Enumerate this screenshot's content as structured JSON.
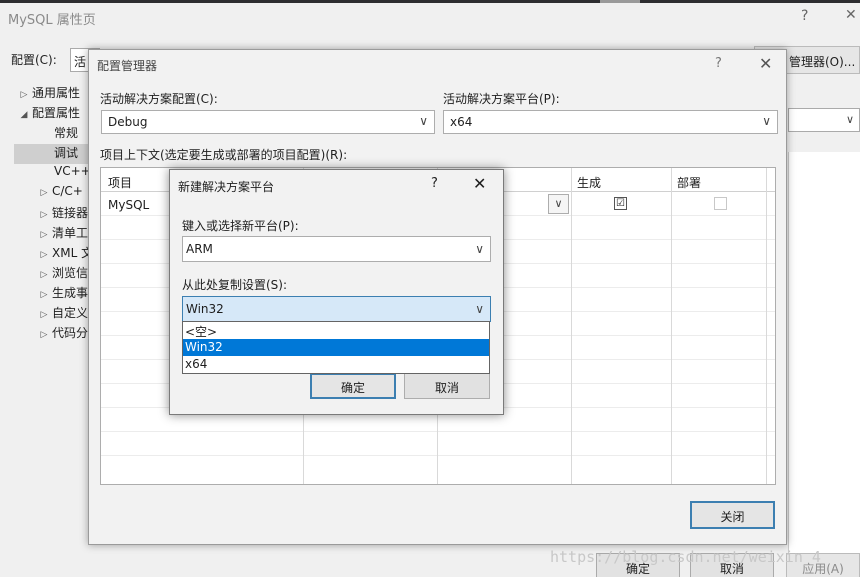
{
  "outer": {
    "title": "MySQL 属性页",
    "help_glyph": "?",
    "close_glyph": "✕",
    "config_label": "配置(C):",
    "config_value": "活",
    "config_manager_button": "管理器(O)...",
    "tree": [
      {
        "label": "通用属性",
        "arrow": "▷"
      },
      {
        "label": "配置属性",
        "arrow": "◢"
      },
      {
        "label": "常规",
        "arrow": ""
      },
      {
        "label": "调试",
        "arrow": "",
        "selected": true
      },
      {
        "label": "VC++",
        "arrow": ""
      },
      {
        "label": "C/C+",
        "arrow": "▷"
      },
      {
        "label": "链接器",
        "arrow": "▷"
      },
      {
        "label": "清单工",
        "arrow": "▷"
      },
      {
        "label": "XML 文",
        "arrow": "▷"
      },
      {
        "label": "浏览信",
        "arrow": "▷"
      },
      {
        "label": "生成事",
        "arrow": "▷"
      },
      {
        "label": "自定义",
        "arrow": "▷"
      },
      {
        "label": "代码分",
        "arrow": "▷"
      }
    ],
    "ok_button": "确定",
    "cancel_button": "取消",
    "apply_button": "应用(A)",
    "watermark": "https://blog.csdn.net/weixin_4"
  },
  "config_manager": {
    "title": "配置管理器",
    "help_glyph": "?",
    "close_glyph": "✕",
    "active_config_label": "活动解决方案配置(C):",
    "active_config_value": "Debug",
    "active_platform_label": "活动解决方案平台(P):",
    "active_platform_value": "x64",
    "project_context_label": "项目上下文(选定要生成或部署的项目配置)(R):",
    "columns": [
      "项目",
      "生成",
      "部署"
    ],
    "rows": [
      {
        "project": "MySQL",
        "build": "☑",
        "deploy": "☐"
      }
    ],
    "close_button": "关闭"
  },
  "new_platform": {
    "title": "新建解决方案平台",
    "help_glyph": "?",
    "close_glyph": "✕",
    "new_platform_label": "键入或选择新平台(P):",
    "new_platform_value": "ARM",
    "copy_from_label": "从此处复制设置(S):",
    "copy_from_value": "Win32",
    "copy_from_options": [
      "<空>",
      "Win32",
      "x64"
    ],
    "copy_from_selected_index": 1,
    "ok_button": "确定",
    "cancel_button": "取消"
  }
}
